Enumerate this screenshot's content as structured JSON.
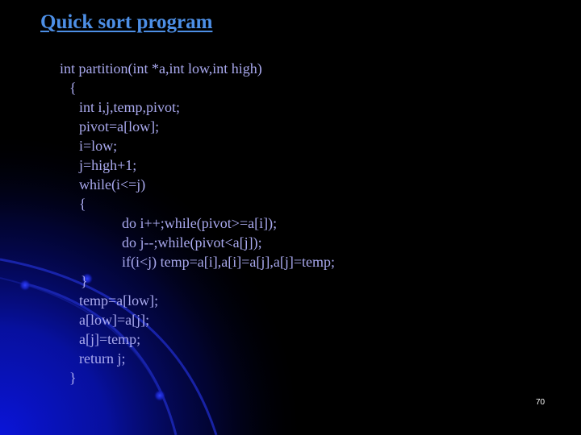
{
  "slide": {
    "title": "Quick sort program",
    "code_lines": [
      "int partition(int *a,int low,int high)",
      "{",
      "int i,j,temp,pivot;",
      "pivot=a[low];",
      "i=low;",
      "j=high+1;",
      "while(i<=j)",
      "{",
      "do i++;while(pivot>=a[i]);",
      "do j--;while(pivot<a[j]);",
      "if(i<j) temp=a[i],a[i]=a[j],a[j]=temp;",
      "}",
      "temp=a[low];",
      "a[low]=a[j];",
      "a[j]=temp;",
      "return j;",
      "}"
    ],
    "page_number": "70"
  },
  "theme": {
    "background": "#000000",
    "title_color": "#4d8fe6",
    "code_color": "#a9a9ee",
    "glow_color": "#0a14c8"
  }
}
